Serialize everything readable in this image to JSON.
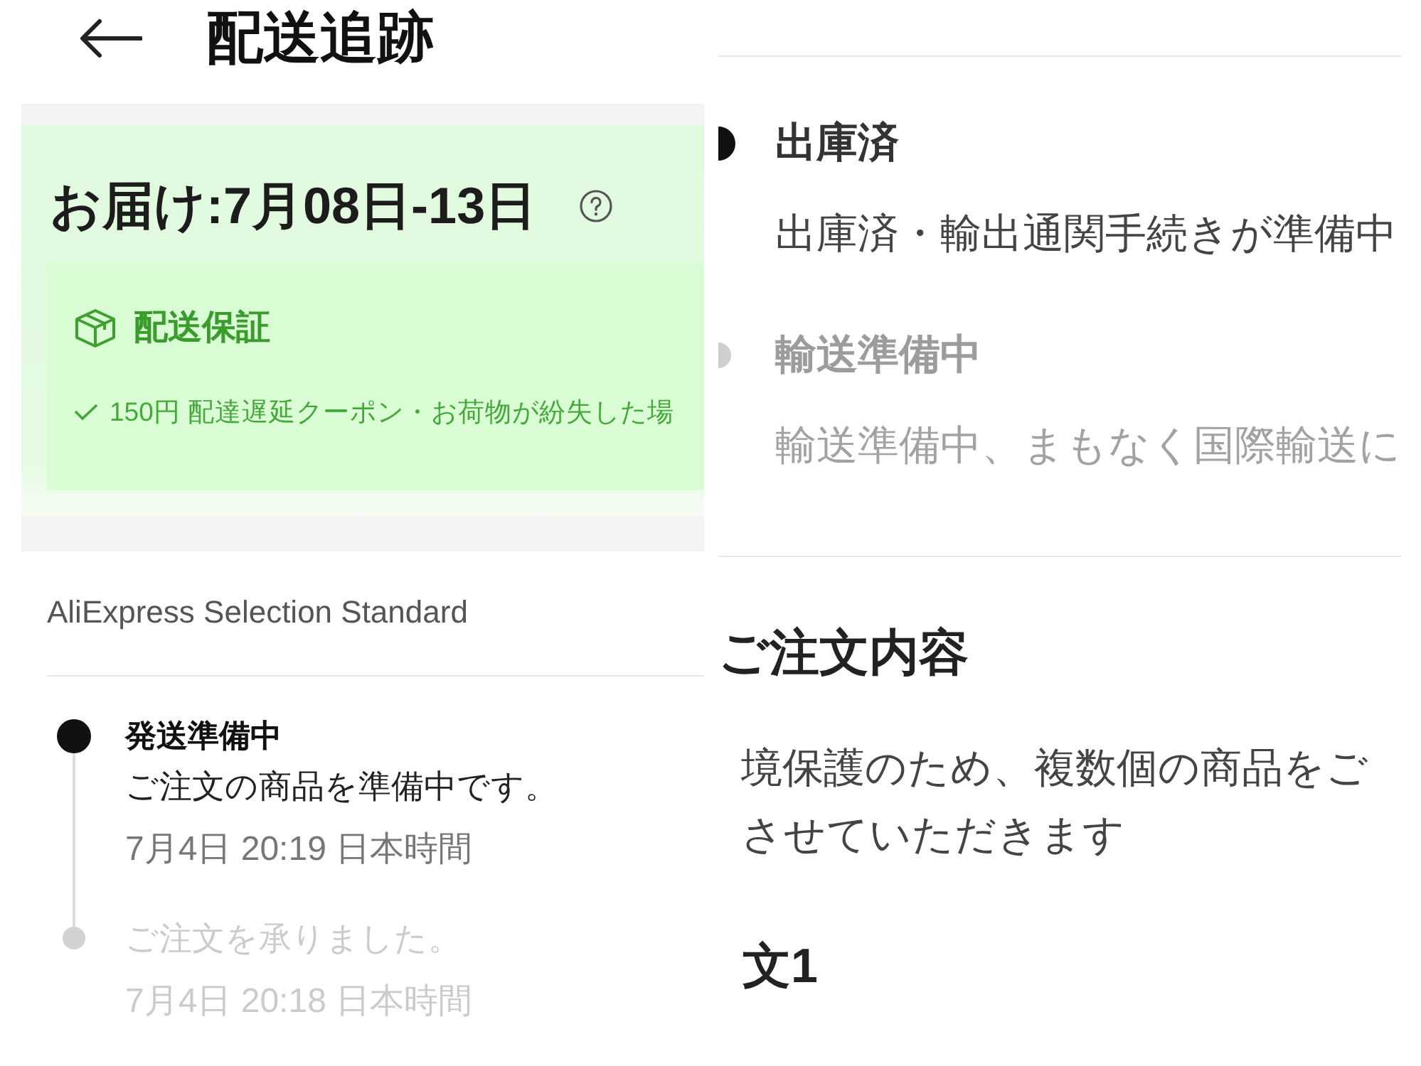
{
  "header": {
    "title": "配送追跡"
  },
  "delivery": {
    "estimate": "お届け:7月08日-13日",
    "guarantee": {
      "title": "配送保証",
      "benefit": "150円 配達遅延クーポン・お荷物が紛失した場"
    }
  },
  "shipping": {
    "method": "AliExpress Selection Standard",
    "events": [
      {
        "title": "発送準備中",
        "description": "ご注文の商品を準備中です。",
        "time": "7月4日 20:19 日本時間",
        "highlighted": true
      },
      {
        "description": "ご注文を承りました。",
        "time": "7月4日 20:18 日本時間",
        "highlighted": false
      }
    ]
  },
  "tracking_continued": {
    "events": [
      {
        "title": "出庫済",
        "description": "出庫済・輸出通関手続きが準備中",
        "highlighted": true
      },
      {
        "title": "輸送準備中",
        "description": "輸送準備中、まもなく国際輸送に",
        "highlighted": false
      }
    ]
  },
  "order_details": {
    "title": "ご注文内容",
    "notice_lines": [
      "境保護のため、複数個の商品をご",
      "させていただきます"
    ],
    "order_label": "文1"
  }
}
